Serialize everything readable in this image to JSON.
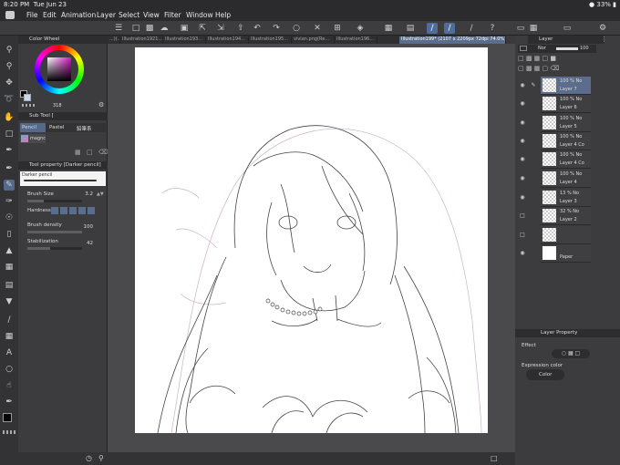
{
  "status": {
    "time": "8:20 PM",
    "date": "Tue Jun 23",
    "battery": "33%"
  },
  "menu": [
    "File",
    "Edit",
    "Animation",
    "Layer",
    "Select",
    "View",
    "Filter",
    "Window",
    "Help"
  ],
  "tabs": [
    "...)(...",
    "Illustration1921...",
    "Illustration193...",
    "Illustration194...",
    "Illustration195...",
    "vivian.png(Re...",
    "Illustration196...",
    "Illustration199* (2107 x 2209px 72dpi 74.0%)"
  ],
  "left_panel": {
    "color_wheel_title": "Color Wheel",
    "hsv": "318",
    "subtool_title": "Sub Tool [",
    "subtools": [
      "Pencil",
      "Pastel",
      "鉛筆系"
    ],
    "subtool_item": "magnc",
    "tool_property_title": "Tool property [Darker pencil]",
    "brush_name": "Darker pencil",
    "props": [
      {
        "label": "Brush Size",
        "value": "3.2"
      },
      {
        "label": "Hardness",
        "value": ""
      },
      {
        "label": "Brush density",
        "value": "100"
      },
      {
        "label": "Stabilization",
        "value": "42"
      }
    ]
  },
  "right_panel": {
    "layer_title": "Layer",
    "blend_mode": "Nor",
    "opacity": "100",
    "layers": [
      {
        "pct": "100 % No",
        "name": "Layer 7",
        "selected": true,
        "visible": true
      },
      {
        "pct": "100 % No",
        "name": "Layer 6",
        "selected": false,
        "visible": true
      },
      {
        "pct": "100 % No",
        "name": "Layer 5",
        "selected": false,
        "visible": true
      },
      {
        "pct": "100 % No",
        "name": "Layer 4 Co",
        "selected": false,
        "visible": true
      },
      {
        "pct": "100 % No",
        "name": "Layer 4 Co",
        "selected": false,
        "visible": true
      },
      {
        "pct": "100 % No",
        "name": "Layer 4",
        "selected": false,
        "visible": true
      },
      {
        "pct": "13 % No",
        "name": "Layer 3",
        "selected": false,
        "visible": true
      },
      {
        "pct": "32 % No",
        "name": "Layer 2",
        "selected": false,
        "visible": false
      },
      {
        "pct": "",
        "name": "",
        "selected": false,
        "visible": false
      },
      {
        "pct": "",
        "name": "Paper",
        "selected": false,
        "visible": true
      }
    ],
    "layer_property_title": "Layer Property",
    "effect_label": "Effect",
    "expression_label": "Expression color",
    "expression_value": "Color"
  },
  "colors": {
    "accent": "#5b6c8c",
    "panel": "#3c3c3f",
    "bar": "#2b2b2d"
  }
}
